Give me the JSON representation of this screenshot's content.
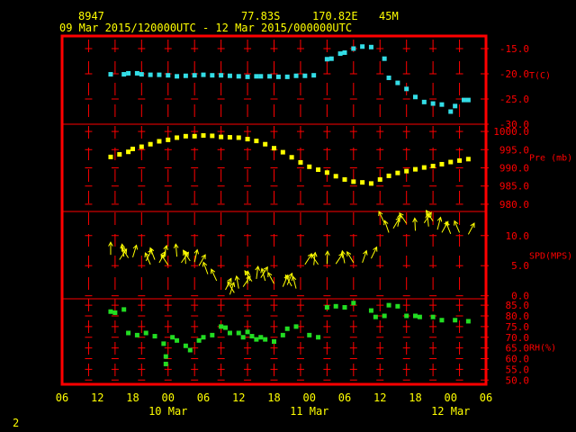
{
  "header": {
    "station_id": "8947",
    "latitude": "77.83S",
    "longitude": "170.82E",
    "elevation": "45M",
    "date_range": "09 Mar 2015/120000UTC - 12 Mar 2015/000000UTC"
  },
  "page_number": "2",
  "colors": {
    "frame": "#ff0000",
    "text": "#ffff00",
    "axis_labels": "#ff0000",
    "temperature": "#33dde6",
    "pressure": "#ffff00",
    "wind": "#ffff00",
    "wind_highlight": "#ff6600",
    "humidity": "#22dd22"
  },
  "x_axis": {
    "ticks": [
      "06",
      "12",
      "18",
      "00",
      "06",
      "12",
      "18",
      "00",
      "06",
      "12",
      "18",
      "00",
      "06"
    ],
    "day_labels": [
      {
        "text": "10 Mar",
        "at_tick": 3
      },
      {
        "text": "11 Mar",
        "at_tick": 7
      },
      {
        "text": "12 Mar",
        "at_tick": 11
      }
    ]
  },
  "chart_data": [
    {
      "type": "scatter",
      "title": "",
      "ylabel": "T(C)",
      "ylim": [
        -30,
        -12.5
      ],
      "yticks": [
        "-15.0",
        "-20.0",
        "-25.0",
        "-30.0"
      ],
      "ytick_values": [
        -15,
        -20,
        -25,
        -30
      ],
      "x_unit": "hours since 09 Mar 06UTC",
      "x": [
        11,
        14,
        15,
        17,
        18,
        20,
        22,
        24,
        26,
        28,
        30,
        32,
        34,
        36,
        38,
        40,
        42,
        44,
        45,
        47,
        49,
        51,
        53,
        55,
        57,
        60,
        61,
        63,
        64,
        66,
        68,
        70,
        73,
        74,
        76,
        78,
        80,
        82,
        84,
        86,
        88,
        89,
        91,
        92
      ],
      "y": [
        -20.1,
        -20.1,
        -19.9,
        -19.9,
        -20.1,
        -20.2,
        -20.2,
        -20.3,
        -20.5,
        -20.4,
        -20.3,
        -20.2,
        -20.3,
        -20.3,
        -20.4,
        -20.5,
        -20.6,
        -20.5,
        -20.5,
        -20.5,
        -20.6,
        -20.6,
        -20.4,
        -20.4,
        -20.3,
        -17.1,
        -17.0,
        -16.0,
        -15.8,
        -15.0,
        -14.6,
        -14.7,
        -17.0,
        -20.8,
        -21.8,
        -23.0,
        -24.6,
        -25.6,
        -25.9,
        -26.1,
        -27.5,
        -26.4,
        -25.2,
        -25.2
      ]
    },
    {
      "type": "scatter",
      "ylabel": "Pre (mb)",
      "ylim": [
        978,
        1002
      ],
      "yticks": [
        "1000.0",
        "995.0",
        "990.0",
        "985.0",
        "980.0"
      ],
      "ytick_values": [
        1000,
        995,
        990,
        985,
        980
      ],
      "x": [
        11,
        13,
        15,
        16,
        18,
        20,
        22,
        24,
        26,
        28,
        30,
        32,
        34,
        36,
        38,
        40,
        42,
        44,
        46,
        48,
        50,
        52,
        54,
        56,
        58,
        60,
        62,
        64,
        66,
        68,
        70,
        72,
        74,
        76,
        78,
        80,
        82,
        84,
        86,
        88,
        90,
        92
      ],
      "y": [
        993.0,
        993.7,
        994.4,
        995.2,
        995.8,
        996.5,
        997.3,
        997.7,
        998.3,
        998.7,
        998.7,
        998.9,
        998.8,
        998.5,
        998.4,
        998.3,
        997.9,
        997.4,
        996.5,
        995.4,
        994.3,
        992.9,
        991.5,
        990.3,
        989.5,
        988.7,
        987.7,
        986.8,
        986.2,
        986.0,
        985.7,
        986.8,
        987.8,
        988.6,
        989.1,
        989.6,
        990.1,
        990.5,
        991.0,
        991.6,
        992.0,
        992.4
      ]
    },
    {
      "type": "scatter",
      "ylabel": "SPD(MPS)",
      "ylim": [
        -0.5,
        14
      ],
      "yticks": [
        "10.0",
        "5.0",
        "0.0"
      ],
      "ytick_values": [
        10,
        5,
        0
      ],
      "x": [
        11,
        13,
        14,
        15,
        16,
        19,
        20,
        21,
        22,
        23,
        24,
        26,
        27,
        28,
        29,
        30,
        31,
        33,
        35,
        37,
        38,
        39,
        40,
        41,
        42,
        43,
        44,
        45,
        46,
        48,
        50,
        51,
        52,
        53,
        55,
        57,
        58,
        60,
        62,
        64,
        66,
        68,
        70,
        73,
        74,
        75,
        76,
        78,
        80,
        82,
        83,
        84,
        85,
        86,
        88,
        90,
        92
      ],
      "y": [
        6.8,
        6.0,
        6.5,
        6.3,
        6.4,
        5.8,
        5.2,
        6.0,
        5.5,
        6.3,
        5.1,
        6.5,
        5.5,
        5.3,
        5.8,
        5.6,
        5.0,
        3.6,
        2.5,
        1.0,
        0.2,
        0.5,
        1.2,
        1.5,
        2.0,
        2.4,
        2.8,
        3.0,
        2.5,
        2.0,
        1.5,
        1.8,
        1.6,
        1.2,
        5.2,
        5.1,
        5.2,
        5.3,
        5.3,
        5.4,
        5.5,
        5.5,
        6.2,
        12.1,
        10.5,
        11.2,
        11.5,
        12.0,
        10.8,
        12.1,
        11.5,
        12.4,
        11.0,
        10.5,
        10.3,
        10.5,
        10.2
      ]
    },
    {
      "type": "scatter",
      "ylabel": "RH(%)",
      "ylim": [
        48,
        88
      ],
      "yticks": [
        "85.0",
        "80.0",
        "75.0",
        "70.0",
        "65.0",
        "60.0",
        "55.0",
        "50.0"
      ],
      "ytick_values": [
        85,
        80,
        75,
        70,
        65,
        60,
        55,
        50
      ],
      "x": [
        11,
        12,
        14,
        15,
        17,
        19,
        21,
        23,
        23.5,
        23.5,
        25,
        26,
        28,
        29,
        31,
        32,
        34,
        36,
        37,
        38,
        40,
        41,
        42,
        43,
        44,
        45,
        46,
        48,
        50,
        51,
        53,
        56,
        58,
        60,
        62,
        64,
        66,
        70,
        71,
        73,
        74,
        76,
        78,
        80,
        81,
        84,
        86,
        89,
        92
      ],
      "y": [
        82.0,
        81.5,
        83.0,
        72.0,
        71.0,
        72.0,
        70.5,
        67.0,
        61.0,
        57.5,
        70.0,
        68.5,
        66.0,
        64.0,
        68.5,
        70.0,
        71.0,
        75.0,
        74.5,
        72.0,
        72.0,
        70.0,
        72.5,
        70.5,
        69.0,
        70.0,
        69.0,
        68.0,
        71.0,
        74.0,
        75.0,
        71.0,
        70.0,
        84.0,
        84.5,
        84.0,
        86.0,
        82.5,
        79.5,
        80.0,
        85.0,
        84.5,
        80.0,
        80.0,
        79.5,
        79.5,
        78.0,
        78.0,
        77.5
      ]
    }
  ]
}
